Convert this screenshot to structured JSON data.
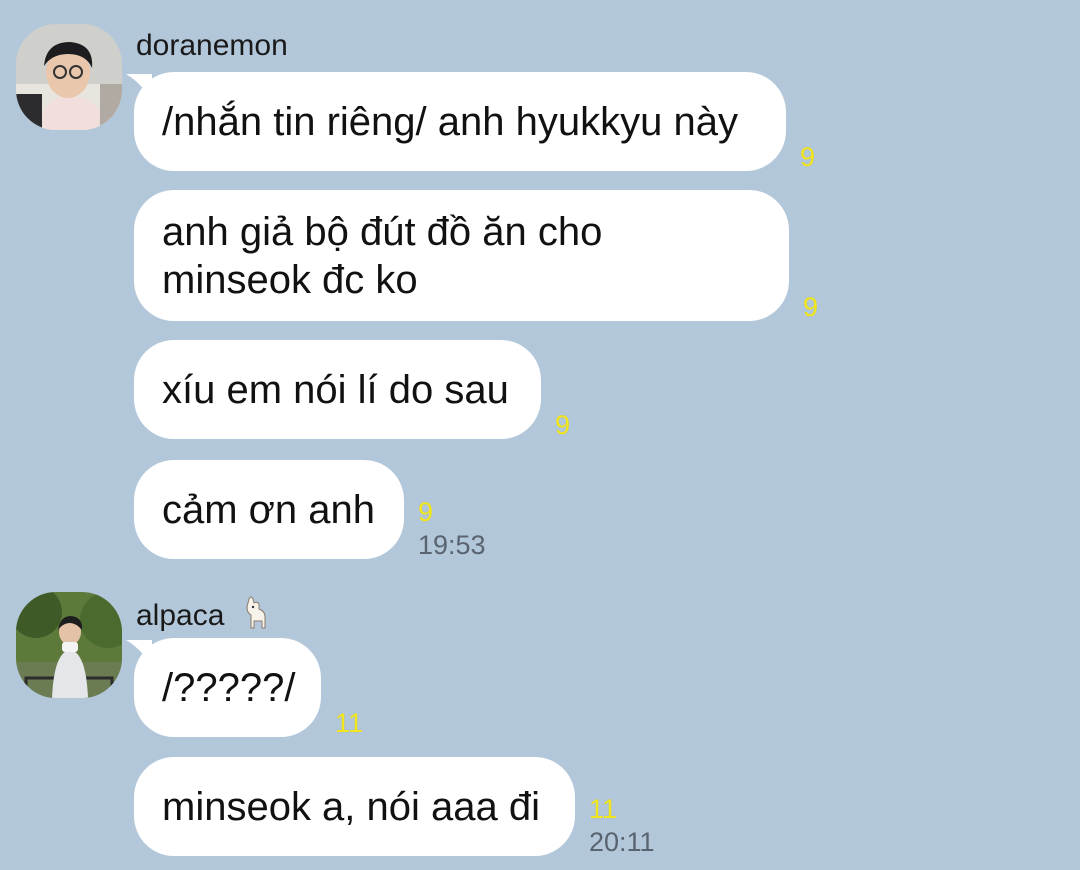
{
  "colors": {
    "background": "#b2c7d9",
    "bubble": "#ffffff",
    "unread_count": "#f2e71d",
    "timestamp": "#5a6470"
  },
  "conversation": [
    {
      "sender": "doranemon",
      "sender_emoji": "",
      "messages": [
        {
          "text": "/nhắn tin riêng/ anh hyukkyu này",
          "unread": "9",
          "time": ""
        },
        {
          "text": "anh giả bộ đút đồ ăn cho minseok đc ko",
          "unread": "9",
          "time": ""
        },
        {
          "text": "xíu em nói lí do sau",
          "unread": "9",
          "time": ""
        },
        {
          "text": "cảm ơn anh",
          "unread": "9",
          "time": "19:53"
        }
      ]
    },
    {
      "sender": "alpaca",
      "sender_emoji": "llama",
      "messages": [
        {
          "text": "/?????/",
          "unread": "11",
          "time": ""
        },
        {
          "text": "minseok a, nói aaa đi",
          "unread": "11",
          "time": "20:11"
        }
      ]
    }
  ]
}
